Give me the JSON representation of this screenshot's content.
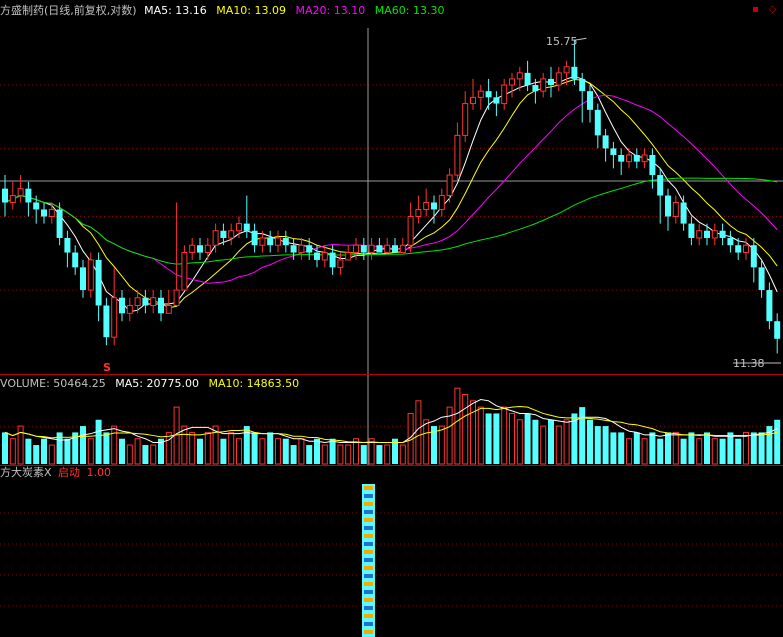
{
  "price_panel": {
    "title": "方盛制药(日线,前复权,对数)",
    "ma5": "MA5: 13.16",
    "ma10": "MA10: 13.09",
    "ma20": "MA20: 13.10",
    "ma60": "MA60: 13.30",
    "high_label": "15.75",
    "low_label": "11.38",
    "signal_marker": "S",
    "colors": {
      "up": "#ff3232",
      "down": "#54ffff",
      "ma5": "#ffffff",
      "ma10": "#ffff00",
      "ma20": "#ff00ff",
      "ma60": "#00e600"
    }
  },
  "volume_panel": {
    "volume": "VOLUME: 50464.25",
    "ma5": "MA5: 20775.00",
    "ma10": "MA10: 14863.50"
  },
  "indicator_panel": {
    "name": "方大炭素X",
    "signal": "启动",
    "value": "1.00"
  },
  "window_buttons": {
    "minimize": "▪",
    "close": "◇"
  },
  "chart_data": {
    "type": "candlestick",
    "high_marker": 15.75,
    "low_marker": 11.38,
    "candles": [
      [
        13.4,
        13.2,
        13.6,
        13.0
      ],
      [
        13.2,
        13.3,
        13.5,
        13.1
      ],
      [
        13.3,
        13.4,
        13.6,
        13.2
      ],
      [
        13.4,
        13.2,
        13.5,
        13.0
      ],
      [
        13.2,
        13.1,
        13.3,
        12.9
      ],
      [
        13.1,
        13.0,
        13.2,
        12.9
      ],
      [
        13.0,
        13.1,
        13.2,
        12.9
      ],
      [
        13.1,
        12.7,
        13.2,
        12.6
      ],
      [
        12.7,
        12.5,
        12.8,
        12.3
      ],
      [
        12.5,
        12.3,
        12.6,
        12.2
      ],
      [
        12.3,
        12.0,
        12.4,
        11.9
      ],
      [
        12.0,
        12.4,
        12.5,
        11.9
      ],
      [
        12.4,
        11.8,
        12.5,
        11.6
      ],
      [
        11.8,
        11.4,
        11.9,
        11.3
      ],
      [
        11.4,
        11.9,
        12.3,
        11.3
      ],
      [
        11.9,
        11.7,
        12.0,
        11.6
      ],
      [
        11.7,
        11.8,
        11.9,
        11.6
      ],
      [
        11.8,
        11.9,
        12.0,
        11.7
      ],
      [
        11.9,
        11.8,
        12.0,
        11.7
      ],
      [
        11.8,
        11.9,
        12.0,
        11.7
      ],
      [
        11.9,
        11.7,
        12.0,
        11.6
      ],
      [
        11.7,
        11.8,
        12.0,
        11.7
      ],
      [
        11.8,
        12.0,
        13.2,
        11.8
      ],
      [
        12.0,
        12.5,
        12.6,
        12.0
      ],
      [
        12.5,
        12.6,
        12.7,
        12.4
      ],
      [
        12.6,
        12.5,
        12.7,
        12.4
      ],
      [
        12.5,
        12.6,
        12.7,
        12.4
      ],
      [
        12.6,
        12.8,
        12.9,
        12.5
      ],
      [
        12.8,
        12.7,
        12.9,
        12.6
      ],
      [
        12.7,
        12.8,
        12.9,
        12.6
      ],
      [
        12.8,
        12.9,
        13.0,
        12.7
      ],
      [
        12.9,
        12.8,
        13.3,
        12.7
      ],
      [
        12.8,
        12.6,
        12.9,
        12.5
      ],
      [
        12.6,
        12.7,
        12.8,
        12.5
      ],
      [
        12.7,
        12.6,
        12.8,
        12.5
      ],
      [
        12.6,
        12.7,
        12.8,
        12.5
      ],
      [
        12.7,
        12.6,
        12.8,
        12.5
      ],
      [
        12.6,
        12.5,
        12.7,
        12.4
      ],
      [
        12.5,
        12.6,
        12.7,
        12.4
      ],
      [
        12.6,
        12.5,
        12.7,
        12.4
      ],
      [
        12.5,
        12.4,
        12.6,
        12.3
      ],
      [
        12.4,
        12.5,
        12.6,
        12.3
      ],
      [
        12.5,
        12.3,
        12.6,
        12.2
      ],
      [
        12.3,
        12.4,
        12.5,
        12.2
      ],
      [
        12.4,
        12.5,
        12.6,
        12.4
      ],
      [
        12.5,
        12.6,
        12.7,
        12.4
      ],
      [
        12.6,
        12.5,
        12.7,
        12.4
      ],
      [
        12.5,
        12.6,
        12.7,
        12.4
      ],
      [
        12.6,
        12.5,
        12.7,
        12.5
      ],
      [
        12.5,
        12.6,
        12.7,
        12.5
      ],
      [
        12.6,
        12.5,
        12.7,
        12.5
      ],
      [
        12.5,
        12.6,
        12.7,
        12.5
      ],
      [
        12.6,
        13.0,
        13.2,
        12.5
      ],
      [
        13.0,
        13.1,
        13.3,
        12.9
      ],
      [
        13.1,
        13.2,
        13.4,
        13.0
      ],
      [
        13.2,
        13.1,
        13.3,
        12.9
      ],
      [
        13.1,
        13.3,
        13.4,
        13.0
      ],
      [
        13.3,
        13.6,
        13.7,
        13.2
      ],
      [
        13.6,
        14.2,
        14.4,
        13.5
      ],
      [
        14.2,
        14.7,
        14.9,
        14.1
      ],
      [
        14.7,
        14.8,
        15.1,
        14.6
      ],
      [
        14.8,
        14.9,
        15.0,
        14.6
      ],
      [
        14.9,
        14.8,
        15.1,
        14.6
      ],
      [
        14.8,
        14.7,
        14.9,
        14.5
      ],
      [
        14.7,
        15.0,
        15.1,
        14.6
      ],
      [
        15.0,
        15.1,
        15.2,
        14.8
      ],
      [
        15.1,
        15.2,
        15.3,
        14.9
      ],
      [
        15.2,
        15.0,
        15.4,
        14.9
      ],
      [
        15.0,
        14.9,
        15.1,
        14.7
      ],
      [
        14.9,
        15.1,
        15.2,
        14.8
      ],
      [
        15.1,
        15.0,
        15.3,
        14.8
      ],
      [
        15.0,
        15.2,
        15.3,
        14.9
      ],
      [
        15.2,
        15.3,
        15.4,
        15.0
      ],
      [
        15.3,
        15.1,
        15.75,
        15.0
      ],
      [
        15.1,
        14.9,
        15.2,
        14.4
      ],
      [
        14.9,
        14.6,
        15.0,
        14.4
      ],
      [
        14.6,
        14.2,
        14.7,
        14.0
      ],
      [
        14.2,
        14.0,
        14.3,
        13.8
      ],
      [
        14.0,
        13.9,
        14.1,
        13.7
      ],
      [
        13.9,
        13.8,
        14.0,
        13.6
      ],
      [
        13.8,
        13.9,
        14.0,
        13.7
      ],
      [
        13.9,
        13.8,
        14.0,
        13.7
      ],
      [
        13.8,
        13.9,
        14.0,
        13.7
      ],
      [
        13.9,
        13.6,
        14.0,
        13.4
      ],
      [
        13.6,
        13.3,
        13.7,
        12.9
      ],
      [
        13.3,
        13.0,
        13.4,
        12.8
      ],
      [
        13.0,
        13.2,
        13.3,
        12.9
      ],
      [
        13.2,
        12.9,
        13.3,
        12.8
      ],
      [
        12.9,
        12.7,
        13.0,
        12.6
      ],
      [
        12.7,
        12.8,
        12.9,
        12.6
      ],
      [
        12.8,
        12.7,
        12.9,
        12.6
      ],
      [
        12.7,
        12.8,
        12.9,
        12.6
      ],
      [
        12.8,
        12.7,
        12.9,
        12.6
      ],
      [
        12.7,
        12.6,
        12.8,
        12.5
      ],
      [
        12.6,
        12.5,
        12.7,
        12.4
      ],
      [
        12.5,
        12.6,
        12.7,
        12.4
      ],
      [
        12.6,
        12.3,
        12.7,
        12.1
      ],
      [
        12.3,
        12.0,
        12.4,
        11.9
      ],
      [
        12.0,
        11.6,
        12.1,
        11.5
      ],
      [
        11.6,
        11.38,
        11.7,
        11.2
      ]
    ],
    "volumes": [
      5,
      4,
      6,
      4,
      3,
      4,
      3,
      5,
      4,
      5,
      6,
      4,
      7,
      5,
      6,
      4,
      3,
      4,
      3,
      3,
      4,
      5,
      9,
      6,
      5,
      4,
      5,
      6,
      4,
      5,
      4,
      6,
      5,
      4,
      5,
      4,
      4,
      3,
      4,
      3,
      4,
      3,
      4,
      3,
      3,
      4,
      3,
      4,
      3,
      3,
      4,
      3,
      8,
      10,
      7,
      6,
      6,
      9,
      12,
      11,
      10,
      9,
      8,
      8,
      9,
      8,
      7,
      8,
      7,
      6,
      7,
      6,
      7,
      8,
      9,
      7,
      6,
      6,
      5,
      5,
      4,
      5,
      4,
      5,
      4,
      5,
      5,
      4,
      5,
      4,
      5,
      4,
      4,
      5,
      4,
      5,
      5,
      5,
      6,
      7
    ]
  }
}
